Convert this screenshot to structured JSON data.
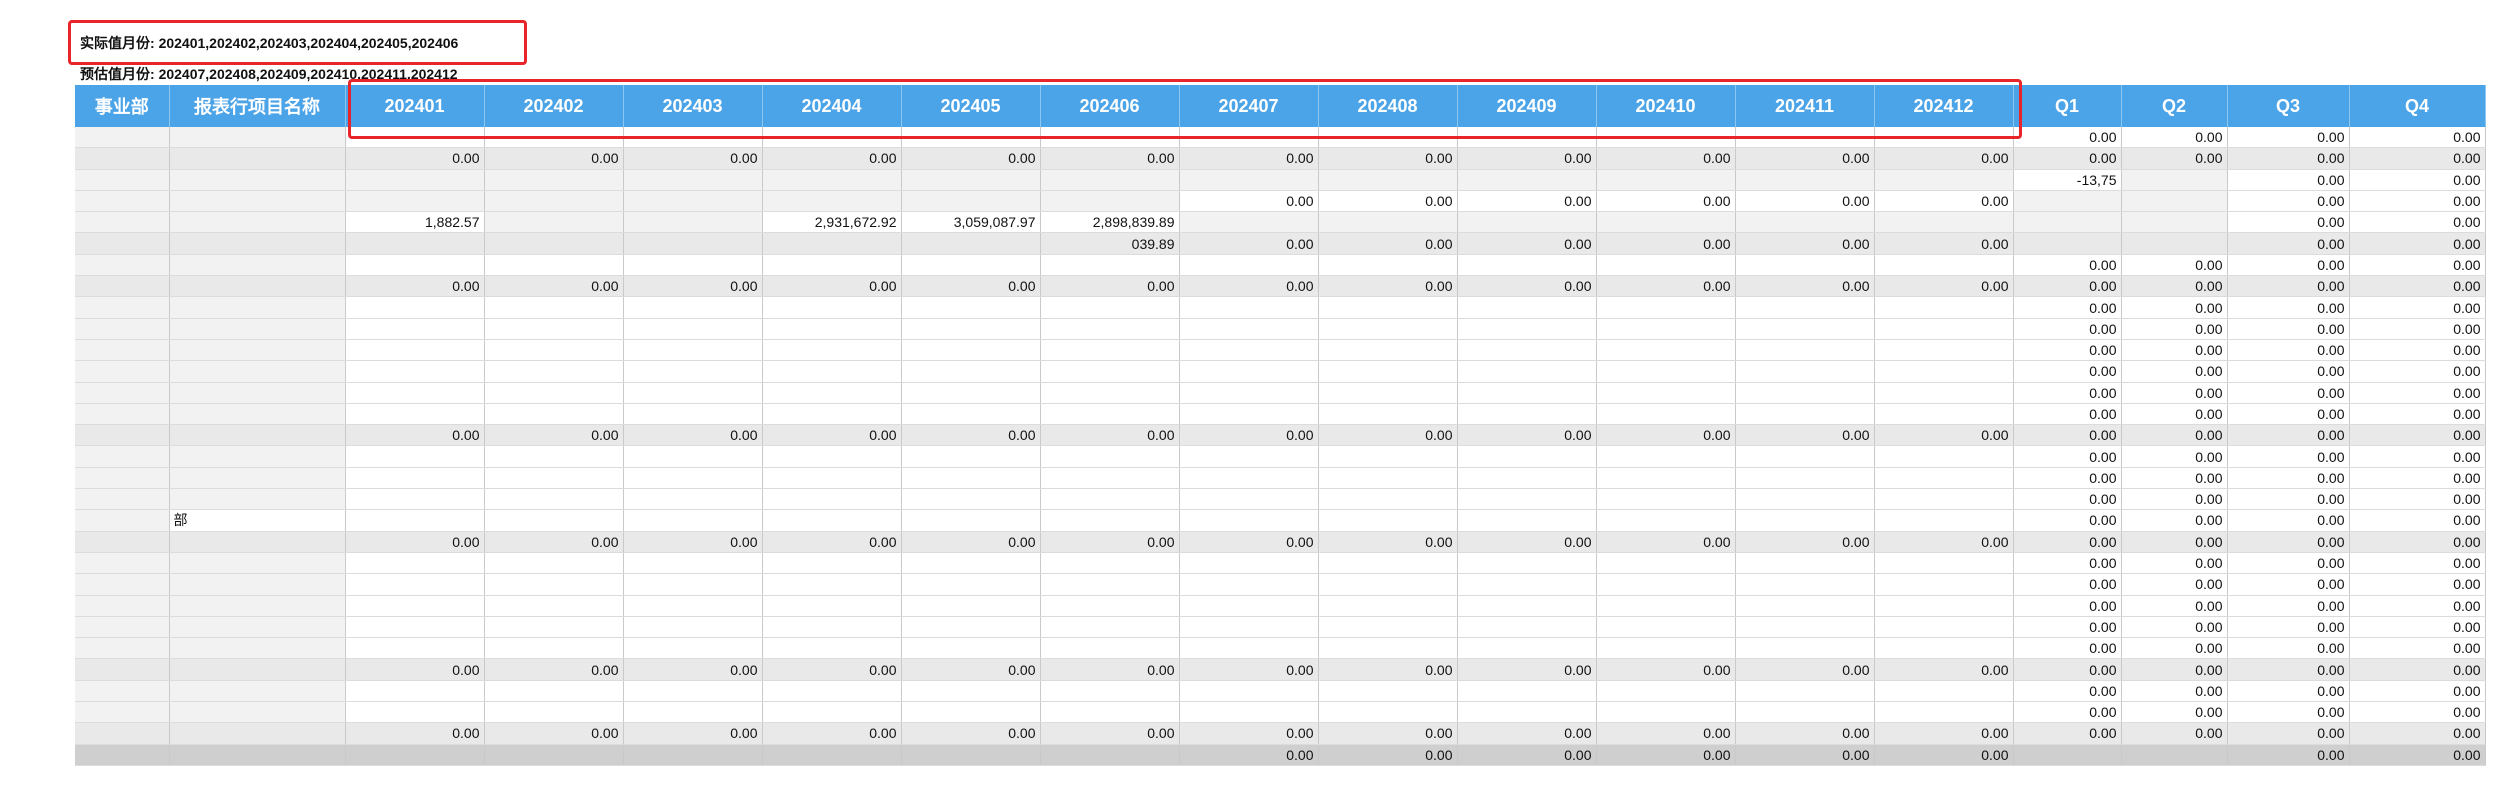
{
  "info": {
    "actual_label": "实际值月份:",
    "actual_months": "202401,202402,202403,202404,202405,202406",
    "estimate_label": "预估值月份:",
    "estimate_months": "202407,202408,202409,202410,202411,202412"
  },
  "table": {
    "headers": [
      "事业部",
      "报表行项目名称",
      "202401",
      "202402",
      "202403",
      "202404",
      "202405",
      "202406",
      "202407",
      "202408",
      "202409",
      "202410",
      "202411",
      "202412",
      "Q1",
      "Q2",
      "Q3",
      "Q4"
    ],
    "rows": [
      {
        "type": "row",
        "cells": [
          "",
          "",
          "",
          "",
          "",
          "",
          "",
          "",
          "",
          "",
          "",
          "",
          "",
          "",
          "0.00",
          "0.00",
          "0.00",
          "0.00"
        ]
      },
      {
        "type": "sub",
        "cells": [
          "",
          "",
          "0.00",
          "0.00",
          "0.00",
          "0.00",
          "0.00",
          "0.00",
          "0.00",
          "0.00",
          "0.00",
          "0.00",
          "0.00",
          "0.00",
          "0.00",
          "0.00",
          "0.00",
          "0.00"
        ]
      },
      {
        "type": "row",
        "cells": [
          "",
          "",
          "",
          "",
          "",
          "",
          "",
          "",
          "",
          "",
          "",
          "",
          "",
          "",
          "-13,75",
          "",
          "0.00",
          "0.00"
        ]
      },
      {
        "type": "row",
        "cells": [
          "",
          "",
          "",
          "",
          "",
          "",
          "",
          "",
          "0.00",
          "0.00",
          "0.00",
          "0.00",
          "0.00",
          "0.00",
          "",
          "",
          "0.00",
          "0.00"
        ]
      },
      {
        "type": "row",
        "cells": [
          "",
          "",
          "1,882.57",
          "",
          "",
          "2,931,672.92",
          "3,059,087.97",
          "2,898,839.89",
          "",
          "",
          "",
          "",
          "",
          "",
          "",
          "",
          "0.00",
          "0.00"
        ]
      },
      {
        "type": "sub",
        "cells": [
          "",
          "",
          "",
          "",
          "",
          "",
          "",
          "039.89",
          "0.00",
          "0.00",
          "0.00",
          "0.00",
          "0.00",
          "0.00",
          "",
          "",
          "0.00",
          "0.00"
        ]
      },
      {
        "type": "row",
        "cells": [
          "",
          "",
          "",
          "",
          "",
          "",
          "",
          "",
          "",
          "",
          "",
          "",
          "",
          "",
          "0.00",
          "0.00",
          "0.00",
          "0.00"
        ]
      },
      {
        "type": "sub",
        "cells": [
          "",
          "",
          "0.00",
          "0.00",
          "0.00",
          "0.00",
          "0.00",
          "0.00",
          "0.00",
          "0.00",
          "0.00",
          "0.00",
          "0.00",
          "0.00",
          "0.00",
          "0.00",
          "0.00",
          "0.00"
        ]
      },
      {
        "type": "row",
        "cells": [
          "",
          "",
          "",
          "",
          "",
          "",
          "",
          "",
          "",
          "",
          "",
          "",
          "",
          "",
          "0.00",
          "0.00",
          "0.00",
          "0.00"
        ]
      },
      {
        "type": "row",
        "cells": [
          "",
          "",
          "",
          "",
          "",
          "",
          "",
          "",
          "",
          "",
          "",
          "",
          "",
          "",
          "0.00",
          "0.00",
          "0.00",
          "0.00"
        ]
      },
      {
        "type": "row",
        "cells": [
          "",
          "",
          "",
          "",
          "",
          "",
          "",
          "",
          "",
          "",
          "",
          "",
          "",
          "",
          "0.00",
          "0.00",
          "0.00",
          "0.00"
        ]
      },
      {
        "type": "row",
        "cells": [
          "",
          "",
          "",
          "",
          "",
          "",
          "",
          "",
          "",
          "",
          "",
          "",
          "",
          "",
          "0.00",
          "0.00",
          "0.00",
          "0.00"
        ]
      },
      {
        "type": "row",
        "cells": [
          "",
          "",
          "",
          "",
          "",
          "",
          "",
          "",
          "",
          "",
          "",
          "",
          "",
          "",
          "0.00",
          "0.00",
          "0.00",
          "0.00"
        ]
      },
      {
        "type": "row",
        "cells": [
          "",
          "",
          "",
          "",
          "",
          "",
          "",
          "",
          "",
          "",
          "",
          "",
          "",
          "",
          "0.00",
          "0.00",
          "0.00",
          "0.00"
        ]
      },
      {
        "type": "sub",
        "cells": [
          "",
          "",
          "0.00",
          "0.00",
          "0.00",
          "0.00",
          "0.00",
          "0.00",
          "0.00",
          "0.00",
          "0.00",
          "0.00",
          "0.00",
          "0.00",
          "0.00",
          "0.00",
          "0.00",
          "0.00"
        ]
      },
      {
        "type": "row",
        "cells": [
          "",
          "",
          "",
          "",
          "",
          "",
          "",
          "",
          "",
          "",
          "",
          "",
          "",
          "",
          "0.00",
          "0.00",
          "0.00",
          "0.00"
        ]
      },
      {
        "type": "row",
        "cells": [
          "",
          "",
          "",
          "",
          "",
          "",
          "",
          "",
          "",
          "",
          "",
          "",
          "",
          "",
          "0.00",
          "0.00",
          "0.00",
          "0.00"
        ]
      },
      {
        "type": "row",
        "cells": [
          "",
          "",
          "",
          "",
          "",
          "",
          "",
          "",
          "",
          "",
          "",
          "",
          "",
          "",
          "0.00",
          "0.00",
          "0.00",
          "0.00"
        ]
      },
      {
        "type": "row",
        "cells": [
          "",
          "部",
          "",
          "",
          "",
          "",
          "",
          "",
          "",
          "",
          "",
          "",
          "",
          "",
          "0.00",
          "0.00",
          "0.00",
          "0.00"
        ]
      },
      {
        "type": "sub",
        "cells": [
          "",
          "",
          "0.00",
          "0.00",
          "0.00",
          "0.00",
          "0.00",
          "0.00",
          "0.00",
          "0.00",
          "0.00",
          "0.00",
          "0.00",
          "0.00",
          "0.00",
          "0.00",
          "0.00",
          "0.00"
        ]
      },
      {
        "type": "row",
        "cells": [
          "",
          "",
          "",
          "",
          "",
          "",
          "",
          "",
          "",
          "",
          "",
          "",
          "",
          "",
          "0.00",
          "0.00",
          "0.00",
          "0.00"
        ]
      },
      {
        "type": "row",
        "cells": [
          "",
          "",
          "",
          "",
          "",
          "",
          "",
          "",
          "",
          "",
          "",
          "",
          "",
          "",
          "0.00",
          "0.00",
          "0.00",
          "0.00"
        ]
      },
      {
        "type": "row",
        "cells": [
          "",
          "",
          "",
          "",
          "",
          "",
          "",
          "",
          "",
          "",
          "",
          "",
          "",
          "",
          "0.00",
          "0.00",
          "0.00",
          "0.00"
        ]
      },
      {
        "type": "row",
        "cells": [
          "",
          "",
          "",
          "",
          "",
          "",
          "",
          "",
          "",
          "",
          "",
          "",
          "",
          "",
          "0.00",
          "0.00",
          "0.00",
          "0.00"
        ]
      },
      {
        "type": "row",
        "cells": [
          "",
          "",
          "",
          "",
          "",
          "",
          "",
          "",
          "",
          "",
          "",
          "",
          "",
          "",
          "0.00",
          "0.00",
          "0.00",
          "0.00"
        ]
      },
      {
        "type": "sub",
        "cells": [
          "",
          "",
          "0.00",
          "0.00",
          "0.00",
          "0.00",
          "0.00",
          "0.00",
          "0.00",
          "0.00",
          "0.00",
          "0.00",
          "0.00",
          "0.00",
          "0.00",
          "0.00",
          "0.00",
          "0.00"
        ]
      },
      {
        "type": "row",
        "cells": [
          "",
          "",
          "",
          "",
          "",
          "",
          "",
          "",
          "",
          "",
          "",
          "",
          "",
          "",
          "0.00",
          "0.00",
          "0.00",
          "0.00"
        ]
      },
      {
        "type": "row",
        "cells": [
          "",
          "",
          "",
          "",
          "",
          "",
          "",
          "",
          "",
          "",
          "",
          "",
          "",
          "",
          "0.00",
          "0.00",
          "0.00",
          "0.00"
        ]
      },
      {
        "type": "sub",
        "cells": [
          "",
          "",
          "0.00",
          "0.00",
          "0.00",
          "0.00",
          "0.00",
          "0.00",
          "0.00",
          "0.00",
          "0.00",
          "0.00",
          "0.00",
          "0.00",
          "0.00",
          "0.00",
          "0.00",
          "0.00"
        ]
      },
      {
        "type": "total",
        "cells": [
          "",
          "",
          "",
          "",
          "",
          "",
          "",
          "",
          "0.00",
          "0.00",
          "0.00",
          "0.00",
          "0.00",
          "0.00",
          "",
          "",
          "0.00",
          "0.00"
        ]
      }
    ]
  },
  "colors": {
    "header_bg": "#4ba3e8",
    "highlight_border": "#e8252b",
    "subtotal_bg": "#e9e9e9",
    "total_bg": "#cfcfcf"
  }
}
